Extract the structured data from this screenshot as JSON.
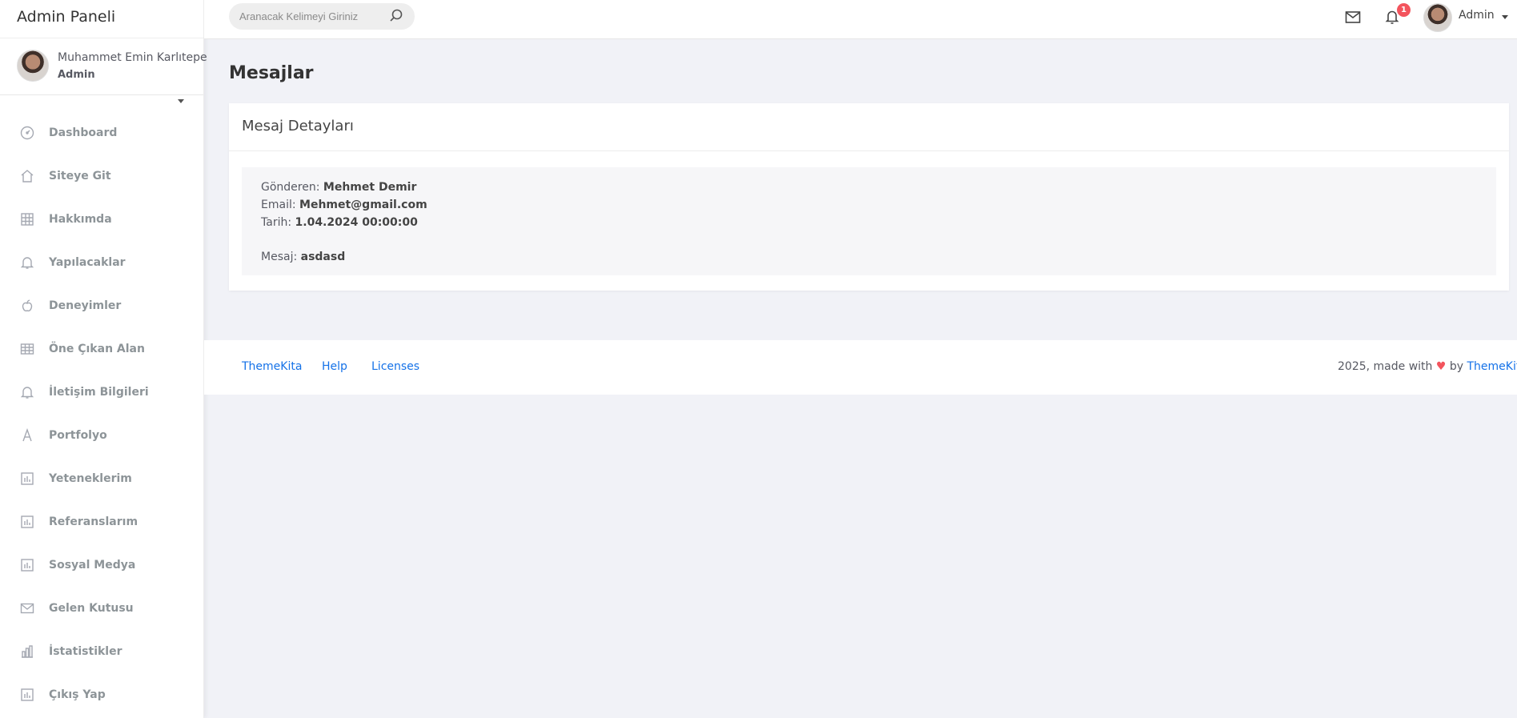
{
  "brand": "Admin Paneli",
  "user": {
    "name": "Muhammet Emin Karlıtepe",
    "role": "Admin"
  },
  "nav": [
    {
      "label": "Dashboard",
      "icon": "dashboard-icon"
    },
    {
      "label": "Siteye Git",
      "icon": "home-icon"
    },
    {
      "label": "Hakkımda",
      "icon": "grid-icon"
    },
    {
      "label": "Yapılacaklar",
      "icon": "bell-icon"
    },
    {
      "label": "Deneyimler",
      "icon": "apple-icon"
    },
    {
      "label": "Öne Çıkan Alan",
      "icon": "table-icon"
    },
    {
      "label": "İletişim Bilgileri",
      "icon": "bell-icon"
    },
    {
      "label": "Portfolyo",
      "icon": "font-icon"
    },
    {
      "label": "Yeteneklerim",
      "icon": "chart-box-icon"
    },
    {
      "label": "Referanslarım",
      "icon": "chart-box-icon"
    },
    {
      "label": "Sosyal Medya",
      "icon": "chart-box-icon"
    },
    {
      "label": "Gelen Kutusu",
      "icon": "envelope-icon"
    },
    {
      "label": "İstatistikler",
      "icon": "bar-chart-icon"
    },
    {
      "label": "Çıkış Yap",
      "icon": "chart-box-icon"
    }
  ],
  "header": {
    "search_placeholder": "Aranacak Kelimeyi Giriniz",
    "notification_count": "1",
    "user_label": "Admin"
  },
  "page": {
    "title": "Mesajlar"
  },
  "card": {
    "title": "Mesaj Detayları",
    "sender_label": "Gönderen:",
    "sender": "Mehmet Demir",
    "email_label": "Email:",
    "email": "Mehmet@gmail.com",
    "date_label": "Tarih:",
    "date": "1.04.2024 00:00:00",
    "message_label": "Mesaj:",
    "message": "asdasd"
  },
  "footer": {
    "links": [
      "ThemeKita",
      "Help",
      "Licenses"
    ],
    "credit_prefix": "2025, made with",
    "heart": "♥",
    "credit_by": "by",
    "credit_link": "ThemeKita"
  },
  "colors": {
    "accent": "#1572e8",
    "badge": "#f3545d",
    "background": "#f1f2f7"
  }
}
